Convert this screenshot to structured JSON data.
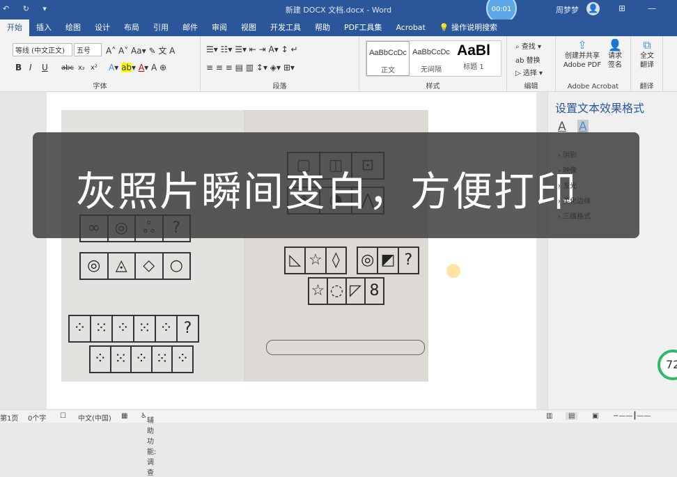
{
  "titlebar": {
    "title": "新建 DOCX 文档.docx - Word",
    "user": "周梦梦",
    "timer": "00:01",
    "quick_access": "↶ ↻ ▾"
  },
  "tabs": [
    "开始",
    "插入",
    "绘图",
    "设计",
    "布局",
    "引用",
    "邮件",
    "审阅",
    "视图",
    "开发工具",
    "帮助",
    "PDF工具集",
    "Acrobat",
    "操作说明搜索"
  ],
  "ribbon": {
    "font": {
      "name": "等线 (中文正文)",
      "size": "五号",
      "label": "字体",
      "buttons": [
        "B",
        "I",
        "U",
        "abc",
        "x₂",
        "x²"
      ]
    },
    "paragraph": {
      "label": "段落"
    },
    "styles": {
      "label": "样式",
      "items": [
        {
          "preview": "AaBbCcDc",
          "name": "正文"
        },
        {
          "preview": "AaBbCcDc",
          "name": "无间隔"
        },
        {
          "preview": "AaBl",
          "name": "标题 1"
        }
      ]
    },
    "editing": {
      "label": "编辑",
      "find": "查找",
      "replace": "替换",
      "select": "选择"
    },
    "acrobat": {
      "label": "Adobe Acrobat",
      "create": "创建并共享 Adobe PDF",
      "sign": "请求 签名"
    },
    "translate": {
      "label": "翻译",
      "full": "全文 翻译"
    }
  },
  "pane": {
    "title": "设置文本效果格式",
    "items": [
      "阴影",
      "映像",
      "发光",
      "柔化边缘",
      "三维格式"
    ]
  },
  "overlay": {
    "caption": "灰照片瞬间变白，方便打印"
  },
  "status": {
    "page": "第1页",
    "words": "0个字",
    "language": "中文(中国)",
    "accessibility": "辅助功能: 调查"
  },
  "badge": "72"
}
